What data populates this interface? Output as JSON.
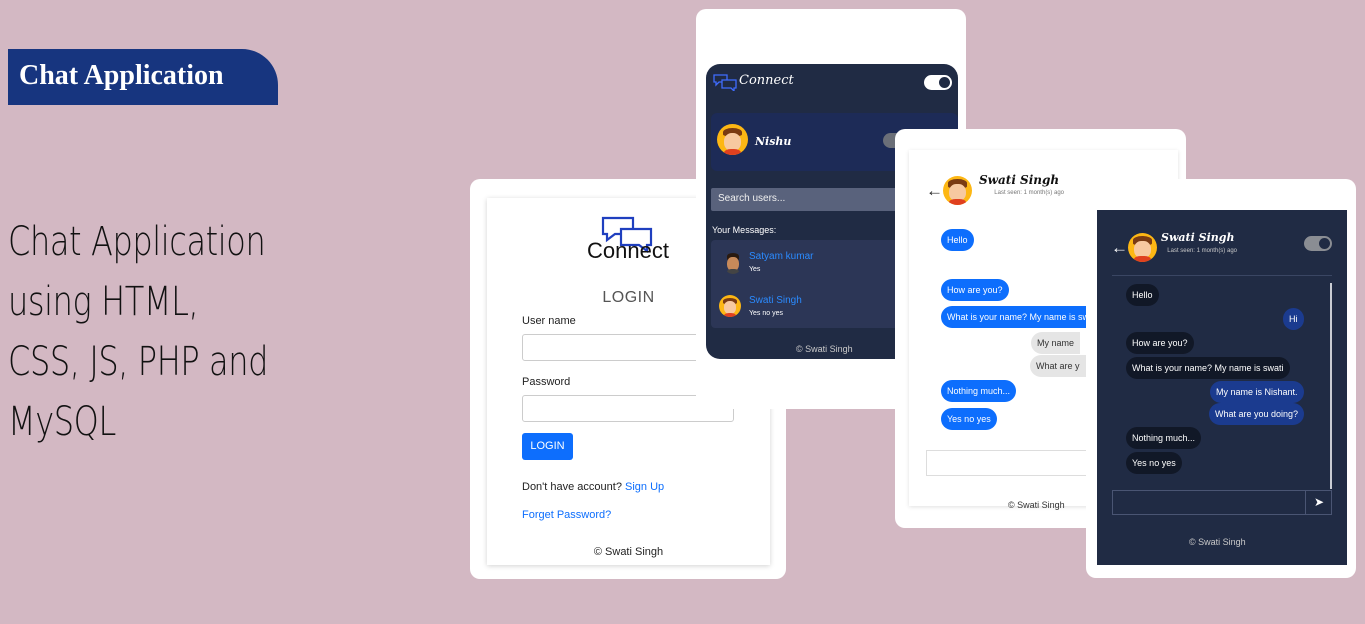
{
  "page": {
    "badge": "Chat Application",
    "headline_line1": "Chat Application using HTML,",
    "headline_line2": "CSS, JS, PHP and MySQL"
  },
  "login": {
    "logo_text": "Connect",
    "title": "LOGIN",
    "username_label": "User name",
    "username_value": "",
    "password_label": "Password",
    "password_value": "",
    "button": "LOGIN",
    "no_account": "Don't have account?",
    "signup": "Sign Up",
    "forget": "Forget Password?",
    "footer": "© Swati Singh"
  },
  "users": {
    "brand": "Connect",
    "current_user": "Nishu",
    "search_placeholder": "Search users...",
    "section_label": "Your Messages:",
    "contacts": [
      {
        "name": "Satyam kumar",
        "last": "Yes"
      },
      {
        "name": "Swati Singh",
        "last": "Yes no yes"
      }
    ],
    "footer": "© Swati Singh"
  },
  "chat_light": {
    "name": "Swati Singh",
    "last_seen": "Last seen: 1 month(s) ago",
    "messages": [
      {
        "text": "Hello",
        "side": "left"
      },
      {
        "text": "How are you?",
        "side": "left"
      },
      {
        "text": "What is your name? My name is sw",
        "side": "left"
      },
      {
        "text": "My name",
        "side": "right"
      },
      {
        "text": "What are y",
        "side": "right"
      },
      {
        "text": "Nothing much...",
        "side": "left"
      },
      {
        "text": "Yes no yes",
        "side": "left"
      }
    ],
    "footer": "© Swati Singh"
  },
  "chat_dark": {
    "name": "Swati Singh",
    "last_seen": "Last seen: 1 month(s) ago",
    "messages": [
      {
        "text": "Hello",
        "side": "left"
      },
      {
        "text": "Hi",
        "side": "right"
      },
      {
        "text": "How are you?",
        "side": "left"
      },
      {
        "text": "What is your name? My name is swati",
        "side": "left"
      },
      {
        "text": "My name is Nishant.",
        "side": "right"
      },
      {
        "text": "What are you doing?",
        "side": "right"
      },
      {
        "text": "Nothing much...",
        "side": "left"
      },
      {
        "text": "Yes no yes",
        "side": "left"
      }
    ],
    "send_icon": "➤",
    "footer": "© Swati Singh"
  },
  "colors": {
    "background": "#d3b8c3",
    "badge": "#17357f",
    "primary": "#0d6efd",
    "dark_panel": "#202b44"
  }
}
